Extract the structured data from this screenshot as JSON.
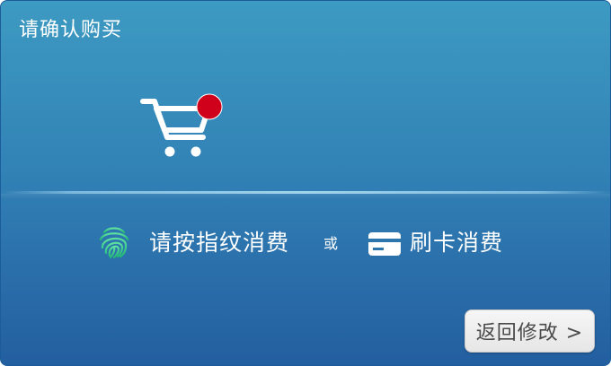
{
  "title": "请确认购买",
  "cart": {
    "icon": "shopping-cart-icon",
    "badge_color": "#d0021b"
  },
  "payment": {
    "fingerprint_icon": "fingerprint-icon",
    "fingerprint_label": "请按指纹消费",
    "or_label": "或",
    "card_icon": "credit-card-icon",
    "card_label": "刷卡消费"
  },
  "back_button": {
    "label": "返回修改 >"
  },
  "colors": {
    "panel_top": "#3d9ac2",
    "panel_bottom": "#235fa0",
    "fingerprint_green": "#37d086",
    "text": "#ffffff"
  }
}
